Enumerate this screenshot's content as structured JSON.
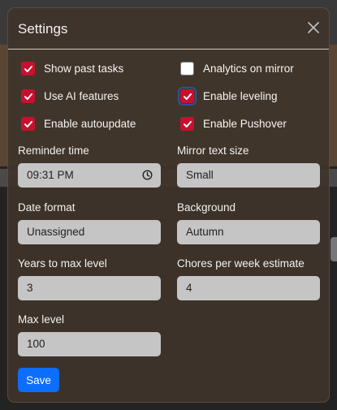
{
  "modal": {
    "title": "Settings",
    "close_icon": "close-icon"
  },
  "checkboxes": [
    {
      "label": "Show past tasks",
      "checked": true
    },
    {
      "label": "Analytics on mirror",
      "checked": false
    },
    {
      "label": "Use AI features",
      "checked": true
    },
    {
      "label": "Enable leveling",
      "checked": true
    },
    {
      "label": "Enable autoupdate",
      "checked": true
    },
    {
      "label": "Enable Pushover",
      "checked": true
    }
  ],
  "fields": {
    "reminder_time": {
      "label": "Reminder time",
      "value": "09:31 PM",
      "icon": "clock-icon"
    },
    "mirror_text_size": {
      "label": "Mirror text size",
      "value": "Small"
    },
    "date_format": {
      "label": "Date format",
      "value": "Unassigned"
    },
    "background": {
      "label": "Background",
      "value": "Autumn"
    },
    "years_to_max_level": {
      "label": "Years to max level",
      "value": "3"
    },
    "chores_per_week": {
      "label": "Chores per week estimate",
      "value": "4"
    },
    "max_level": {
      "label": "Max level",
      "value": "100"
    }
  },
  "save_label": "Save",
  "colors": {
    "checkbox_checked": "#c8102e",
    "save_button": "#0d6efd",
    "field_bg": "#c5c5c5"
  }
}
